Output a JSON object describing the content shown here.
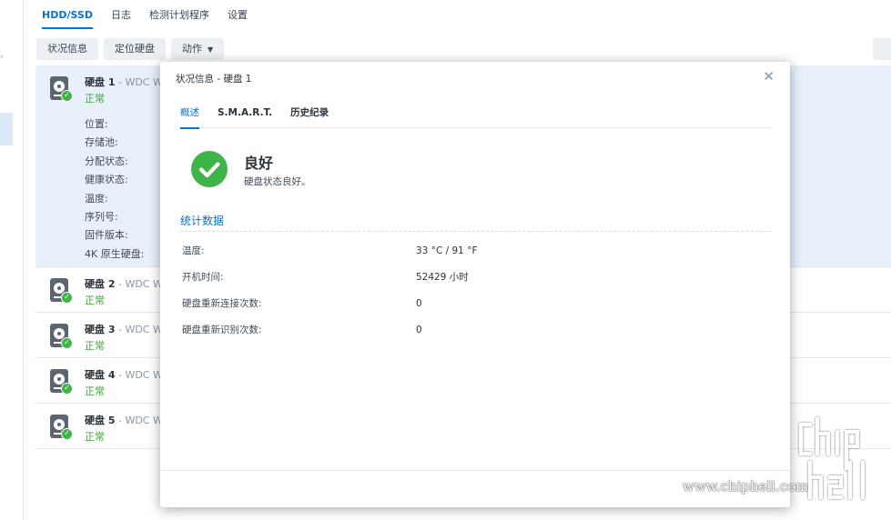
{
  "tabs": [
    "HDD/SSD",
    "日志",
    "检测计划程序",
    "设置"
  ],
  "toolbar": {
    "status_info": "状况信息",
    "locate_disk": "定位硬盘",
    "action": "动作"
  },
  "disks": [
    {
      "label": "硬盘 1",
      "model": "- WDC W",
      "status": "正常"
    },
    {
      "label": "硬盘 2",
      "model": "- WDC W",
      "status": "正常"
    },
    {
      "label": "硬盘 3",
      "model": "- WDC W",
      "status": "正常"
    },
    {
      "label": "硬盘 4",
      "model": "- WDC W",
      "status": "正常"
    },
    {
      "label": "硬盘 5",
      "model": "- WDC W",
      "status": "正常"
    }
  ],
  "disk_props": [
    "位置:",
    "存储池:",
    "分配状态:",
    "健康状态:",
    "温度:",
    "序列号:",
    "固件版本:",
    "4K 原生硬盘:"
  ],
  "modal": {
    "title": "状况信息 - 硬盘 1",
    "tabs": [
      "概述",
      "S.M.A.R.T.",
      "历史纪录"
    ],
    "health_title": "良好",
    "health_desc": "硬盘状态良好。",
    "section_title": "统计数据",
    "stats": [
      {
        "label": "温度:",
        "value": "33 °C / 91 °F"
      },
      {
        "label": "开机时间:",
        "value": "52429 小时"
      },
      {
        "label": "硬盘重新连接次数:",
        "value": "0"
      },
      {
        "label": "硬盘重新识别次数:",
        "value": "0"
      }
    ]
  },
  "watermark": {
    "site": "www.chiphell.com"
  },
  "colors": {
    "accent": "#0a72d1",
    "ok_green": "#3fb549",
    "selected_row": "#e8f1fb"
  },
  "icons": [
    "hdd-icon",
    "check-icon",
    "close-icon",
    "chevron-down-icon",
    "caret-down-icon"
  ]
}
